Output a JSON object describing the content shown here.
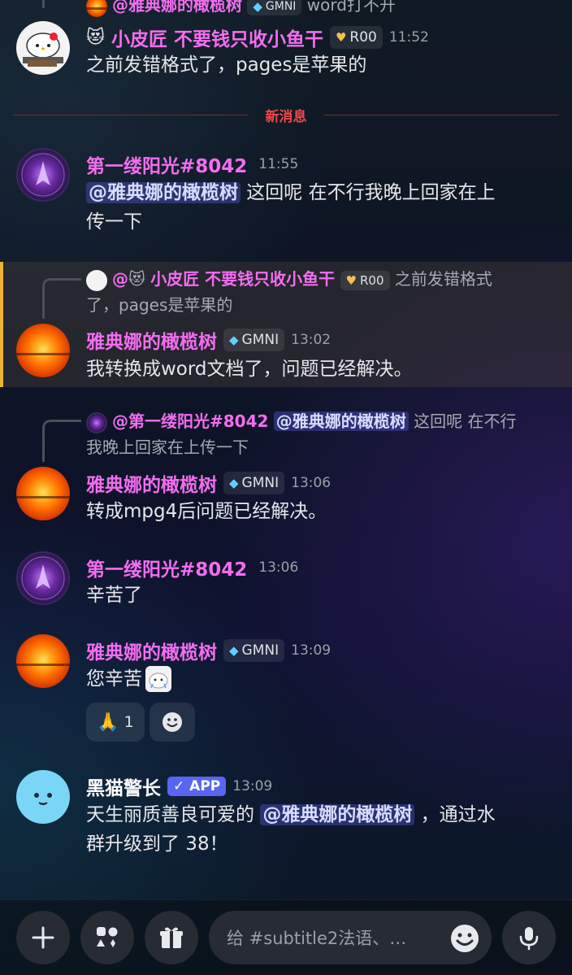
{
  "top_partial": {
    "reply_prefix": "@雅典娜的橄榄树",
    "badge": "GMNI",
    "text": "word打不开"
  },
  "messages": [
    {
      "author": "小皮匠 不要钱只收小鱼干",
      "emoji": "😻",
      "badge": "R00",
      "time": "11:52",
      "text": "之前发错格式了，pages是苹果的"
    },
    {
      "author": "第一缕阳光#8042",
      "time": "11:55",
      "mention": "@雅典娜的橄榄树",
      "text": " 这回呢 在不行我晚上回家在上",
      "text2": "传一下"
    },
    {
      "reply_prefix": "@",
      "reply_emoji": "😻",
      "reply_author": "小皮匠 不要钱只收小鱼干",
      "reply_badge": "R00",
      "reply_text": " 之前发错格式",
      "reply_text2": "了，pages是苹果的",
      "author": "雅典娜的橄榄树",
      "badge": "GMNI",
      "time": "13:02",
      "text": "我转换成word文档了，问题已经解决。"
    },
    {
      "reply_author": "@第一缕阳光#8042",
      "reply_mention": "@雅典娜的橄榄树",
      "reply_text": " 这回呢 在不行",
      "reply_text2": "我晚上回家在上传一下",
      "author": "雅典娜的橄榄树",
      "badge": "GMNI",
      "time": "13:06",
      "text": "转成mpg4后问题已经解决。"
    },
    {
      "author": "第一缕阳光#8042",
      "time": "13:06",
      "text": "辛苦了"
    },
    {
      "author": "雅典娜的橄榄树",
      "badge": "GMNI",
      "time": "13:09",
      "text": "您辛苦",
      "reaction_emoji": "🙏",
      "reaction_count": "1"
    },
    {
      "author": "黑猫警长",
      "badge": "✓ APP",
      "time": "13:09",
      "text": "天生丽质善良可爱的 ",
      "mention": "@雅典娜的橄榄树",
      "text_after": " ，通过水",
      "text2": "群升级到了 38！"
    }
  ],
  "divider_label": "新消息",
  "composer": {
    "placeholder": "给 #subtitle2法语、…"
  },
  "colors": {
    "username": "#f36df0",
    "new_messages": "#f04747",
    "highlight_bar": "#f0b232",
    "mention_bg": "#5865f2"
  },
  "icons": [
    "plus-icon",
    "apps-icon",
    "gift-icon",
    "emoji-icon",
    "microphone-icon",
    "add-reaction-icon"
  ]
}
